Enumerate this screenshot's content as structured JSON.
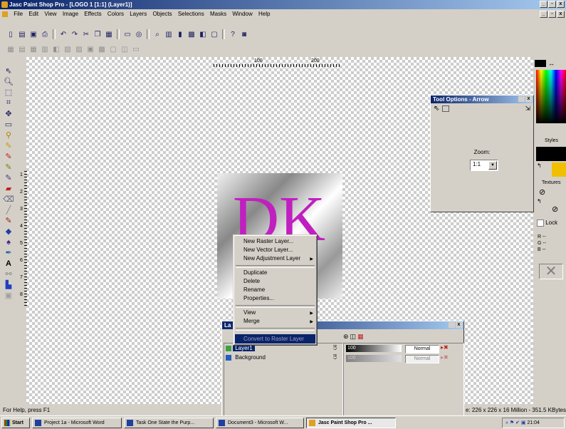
{
  "window": {
    "title": "Jasc Paint Shop Pro - [LOGO 1 [1:1] (Layer1)]"
  },
  "menu": [
    "File",
    "Edit",
    "View",
    "Image",
    "Effects",
    "Colors",
    "Layers",
    "Objects",
    "Selections",
    "Masks",
    "Window",
    "Help"
  ],
  "ruler": {
    "top_labels": [
      "100",
      "200"
    ],
    "left_labels": [
      "1",
      "2",
      "3",
      "4",
      "5",
      "6",
      "7",
      "8"
    ]
  },
  "image": {
    "text": "DK"
  },
  "context_menu": {
    "items": [
      {
        "label": "New Raster Layer..."
      },
      {
        "label": "New Vector Layer..."
      },
      {
        "label": "New Adjustment Layer",
        "submenu": true
      },
      {
        "label": "Duplicate"
      },
      {
        "label": "Delete"
      },
      {
        "label": "Rename"
      },
      {
        "label": "Properties..."
      },
      {
        "label": "View",
        "submenu": true
      },
      {
        "label": "Merge",
        "submenu": true
      },
      {
        "label": "Convert to Raster Layer",
        "highlighted": true
      }
    ]
  },
  "tool_options": {
    "title": "Tool Options - Arrow",
    "zoom_label": "Zoom:",
    "zoom_value": "1:1"
  },
  "color_palette": {
    "styles": "Styles",
    "textures": "Textures",
    "lock": "Lock",
    "r": "R",
    "g": "G",
    "b": "B",
    "dash": "--"
  },
  "layers": {
    "title": "La",
    "rows": [
      {
        "name": "Layer1",
        "opacity": "100",
        "blend": "Normal",
        "selected": true
      },
      {
        "name": "Background",
        "opacity": "100",
        "blend": "Normal",
        "selected": false
      }
    ]
  },
  "status": {
    "help": "For Help, press F1",
    "image_info": "e: 226 x 226 x 16 Million - 351.5 KBytes"
  },
  "taskbar": {
    "start": "Start",
    "tasks": [
      "Project 1a - Microsoft Word",
      "Task One State the Purp...",
      "Document3 - Microsoft W...",
      "Jasc Paint Shop Pro ..."
    ],
    "clock": "21:04"
  },
  "colors": {
    "titlebar": "#0a246a",
    "accent": "#c020c0",
    "highlight": "#0a246a"
  }
}
